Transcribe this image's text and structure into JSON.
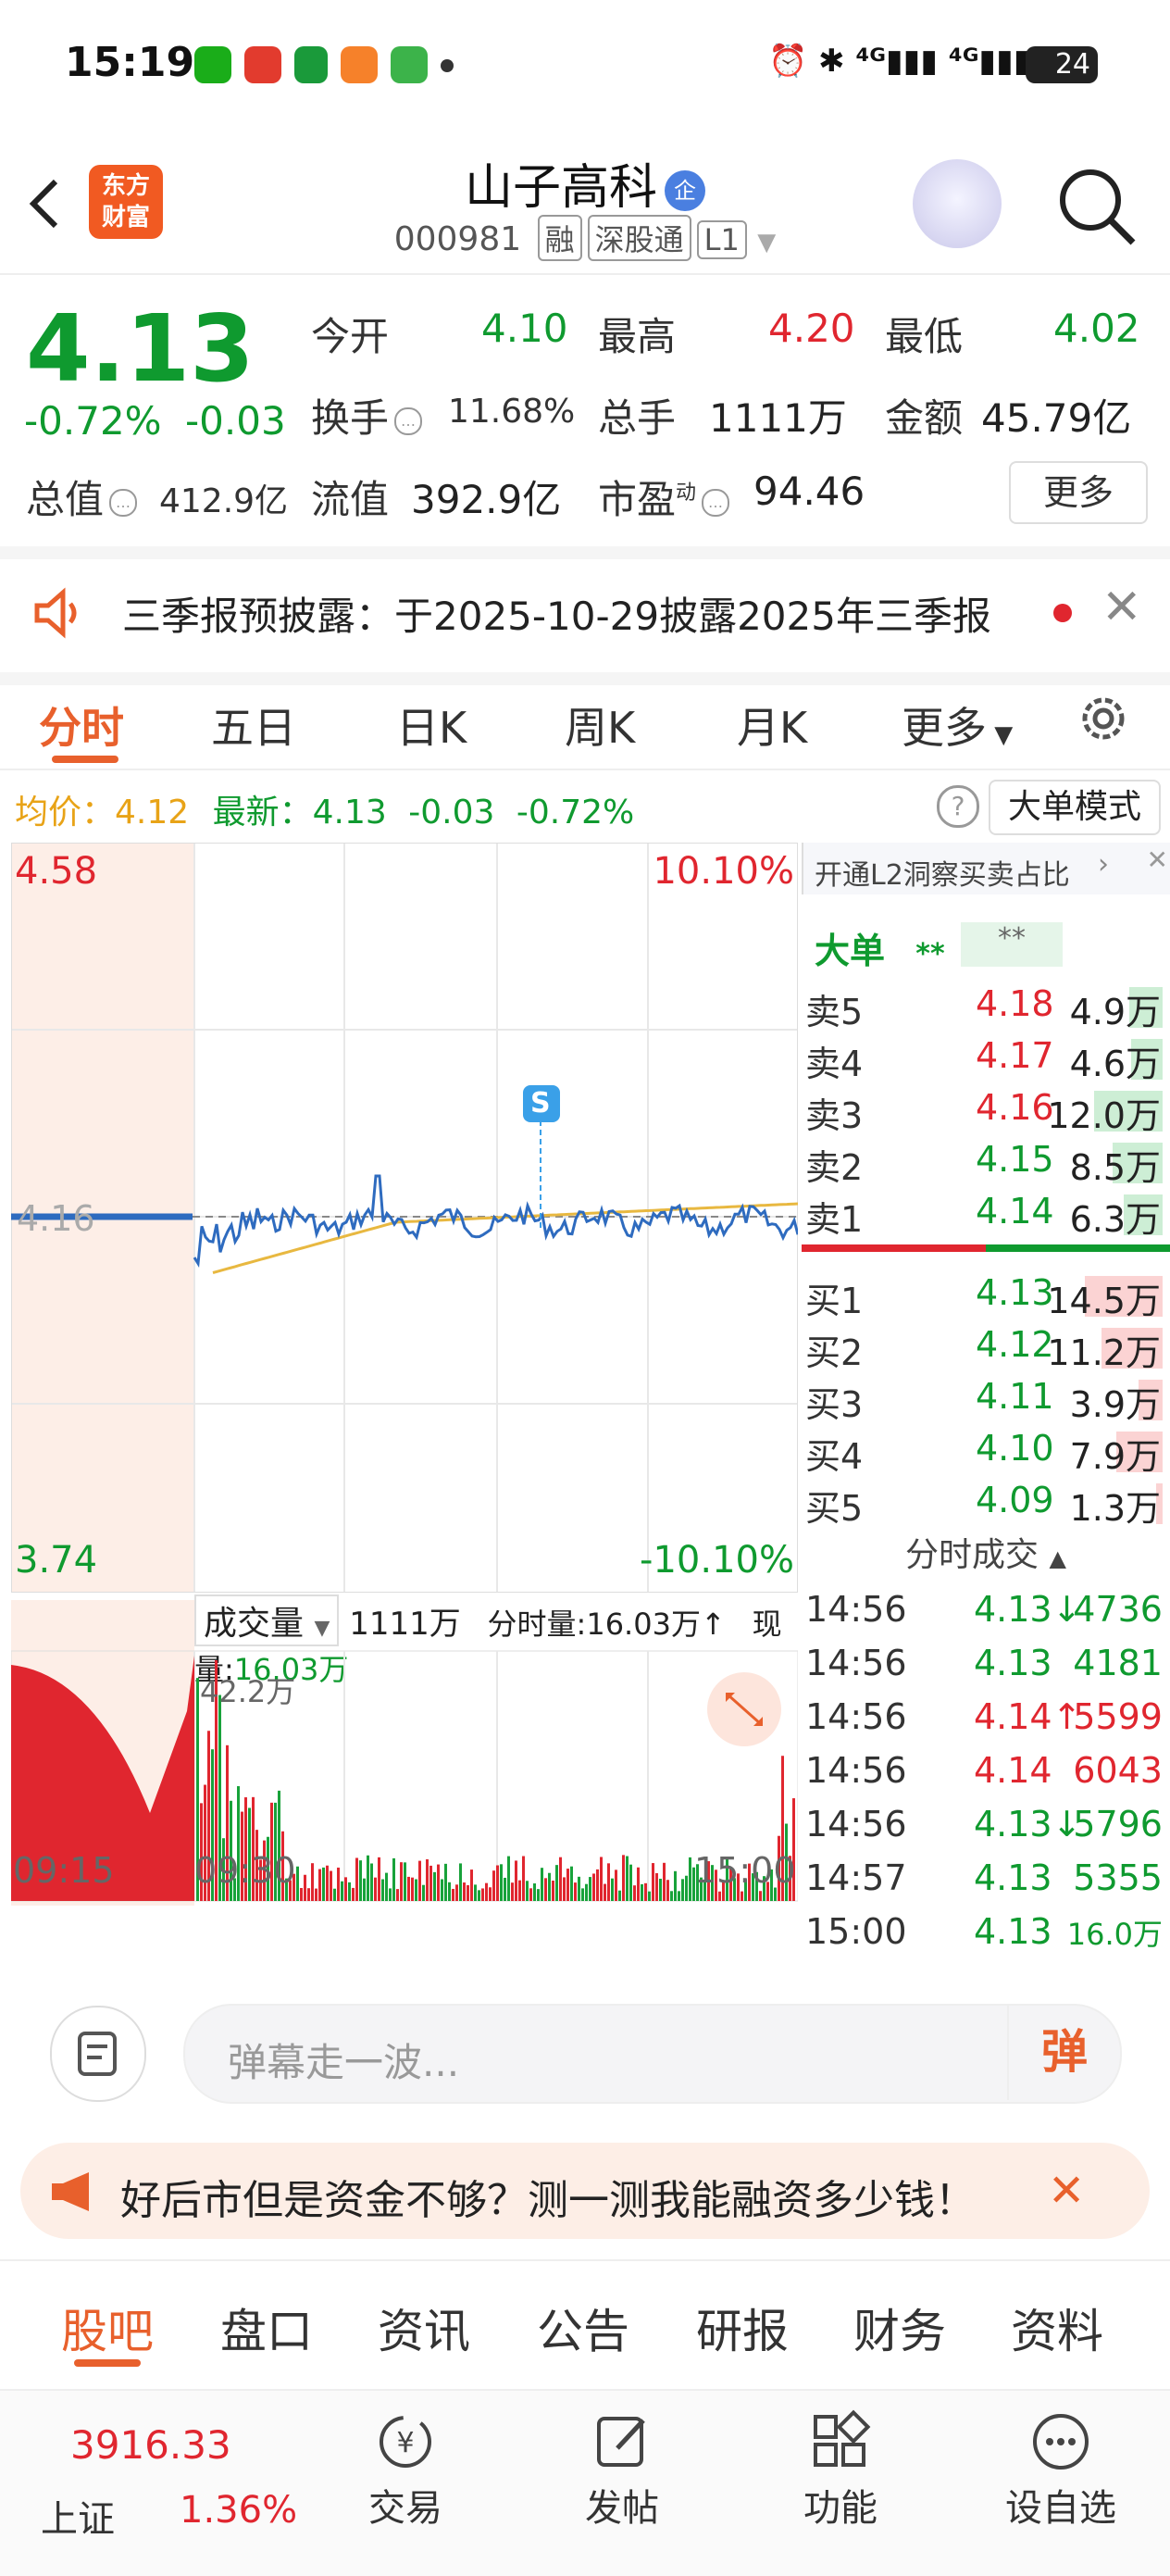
{
  "status_bar": {
    "time": "15:19",
    "battery": "24"
  },
  "header": {
    "title": "山子高科",
    "enterprise_badge": "企",
    "code": "000981",
    "tags": [
      "融",
      "深股通",
      "L1"
    ],
    "logo_line1": "东方",
    "logo_line2": "财富"
  },
  "quote": {
    "price": "4.13",
    "change_pct": "-0.72%",
    "change": "-0.03",
    "open_label": "今开",
    "open": "4.10",
    "high_label": "最高",
    "high": "4.20",
    "low_label": "最低",
    "low": "4.02",
    "turnover_label": "换手",
    "turnover": "11.68%",
    "volume_label": "总手",
    "volume": "1111万",
    "amount_label": "金额",
    "amount": "45.79亿",
    "mktcap_label": "总值",
    "mktcap": "412.9亿",
    "float_label": "流值",
    "float": "392.9亿",
    "pe_label": "市盈",
    "pe_sup": "动",
    "pe": "94.46",
    "more": "更多"
  },
  "notice": {
    "text": "三季报预披露：于2025-10-29披露2025年三季报"
  },
  "tabs": [
    "分时",
    "五日",
    "日K",
    "周K",
    "月K",
    "更多"
  ],
  "avg_line": {
    "avg_label": "均价：",
    "avg": "4.12",
    "latest_label": "最新：",
    "latest": "4.13",
    "chg": "-0.03",
    "pct": "-0.72%",
    "mode_button": "大单模式"
  },
  "chart_labels": {
    "top_price": "4.58",
    "bottom_price": "3.74",
    "top_pct": "10.10%",
    "bottom_pct": "-10.10%",
    "ref_price": "4.16",
    "s_marker": "S"
  },
  "volume_panel": {
    "selector": "成交量",
    "total": "1111万",
    "minute_vol": "分时量:16.03万↑",
    "now_vol_label": "现量:",
    "now_vol": "16.03万",
    "peak": "42.2万",
    "times": [
      "09:15",
      "09:30",
      "15:00"
    ]
  },
  "orderbook": {
    "promo": "开通L2洞察买卖占比",
    "big_label": "大单",
    "big_a": "**",
    "big_b": "**",
    "asks": [
      {
        "label": "卖5",
        "price": "4.18",
        "vol": "4.9万",
        "bar": 0.3
      },
      {
        "label": "卖4",
        "price": "4.17",
        "vol": "4.6万",
        "bar": 0.28
      },
      {
        "label": "卖3",
        "price": "4.16",
        "vol": "12.0万",
        "bar": 0.62
      },
      {
        "label": "卖2",
        "price": "4.15",
        "vol": "8.5万",
        "bar": 0.45
      },
      {
        "label": "卖1",
        "price": "4.14",
        "vol": "6.3万",
        "bar": 0.35
      }
    ],
    "bids": [
      {
        "label": "买1",
        "price": "4.13",
        "vol": "14.5万",
        "bar": 0.7
      },
      {
        "label": "买2",
        "price": "4.12",
        "vol": "11.2万",
        "bar": 0.55
      },
      {
        "label": "买3",
        "price": "4.11",
        "vol": "3.9万",
        "bar": 0.22
      },
      {
        "label": "买4",
        "price": "4.10",
        "vol": "7.9万",
        "bar": 0.42
      },
      {
        "label": "买5",
        "price": "4.09",
        "vol": "1.3万",
        "bar": 0.06
      }
    ],
    "trades_title": "分时成交",
    "trades": [
      {
        "time": "14:56",
        "price": "4.13",
        "dir": "↓",
        "vol": "4736",
        "color": "green"
      },
      {
        "time": "14:56",
        "price": "4.13",
        "dir": "",
        "vol": "4181",
        "color": "green"
      },
      {
        "time": "14:56",
        "price": "4.14",
        "dir": "↑",
        "vol": "5599",
        "color": "red"
      },
      {
        "time": "14:56",
        "price": "4.14",
        "dir": "",
        "vol": "6043",
        "color": "red"
      },
      {
        "time": "14:56",
        "price": "4.13",
        "dir": "↓",
        "vol": "5796",
        "color": "green"
      },
      {
        "time": "14:57",
        "price": "4.13",
        "dir": "",
        "vol": "5355",
        "color": "green"
      },
      {
        "time": "15:00",
        "price": "4.13",
        "dir": "",
        "vol": "16.0万",
        "color": "green"
      }
    ]
  },
  "danmu": {
    "placeholder": "弹幕走一波...",
    "button": "弹"
  },
  "promo": {
    "text": "好后市但是资金不够？测一测我能融资多少钱！"
  },
  "section_tabs": [
    "股吧",
    "盘口",
    "资讯",
    "公告",
    "研报",
    "财务",
    "资料"
  ],
  "bottom_nav": {
    "index_value": "3916.33",
    "index_name": "上证",
    "index_pct": "1.36%",
    "items": [
      "交易",
      "发帖",
      "功能",
      "设自选"
    ]
  }
}
